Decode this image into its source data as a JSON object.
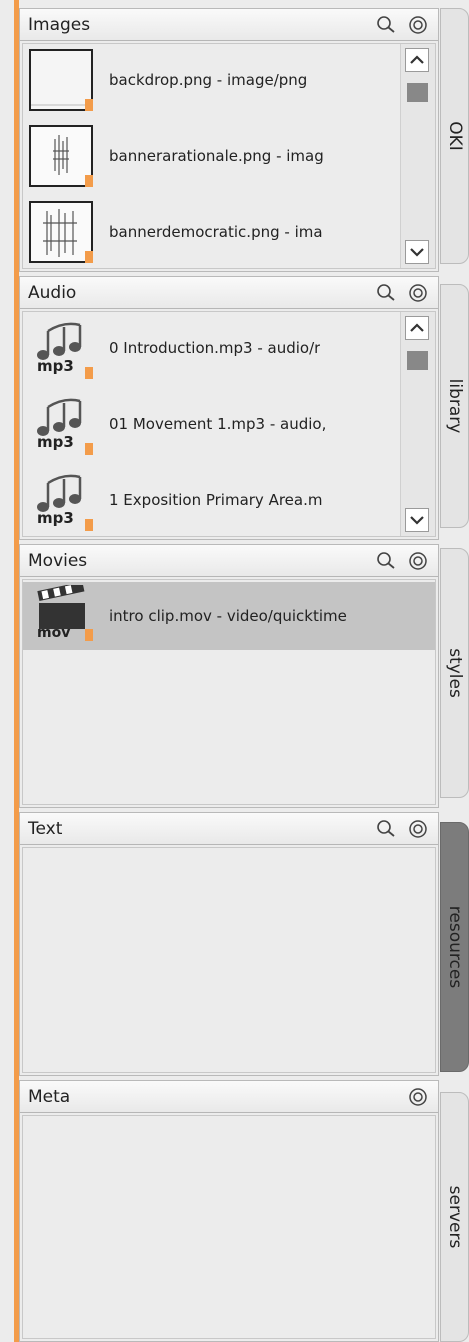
{
  "accent_color": "#f39c4a",
  "panels": {
    "images": {
      "title": "Images",
      "items": [
        {
          "label": "backdrop.png - image/png",
          "icon": "image-thumbnail-icon"
        },
        {
          "label": "bannerarationale.png - imag",
          "icon": "image-thumbnail-icon"
        },
        {
          "label": "bannerdemocratic.png - ima",
          "icon": "image-thumbnail-icon"
        }
      ]
    },
    "audio": {
      "title": "Audio",
      "items": [
        {
          "label": "0 Introduction.mp3 - audio/r",
          "icon": "mp3-icon",
          "badge": "mp3"
        },
        {
          "label": "01 Movement 1.mp3 - audio,",
          "icon": "mp3-icon",
          "badge": "mp3"
        },
        {
          "label": "1 Exposition Primary Area.m",
          "icon": "mp3-icon",
          "badge": "mp3"
        }
      ]
    },
    "movies": {
      "title": "Movies",
      "items": [
        {
          "label": "intro clip.mov - video/quicktime",
          "icon": "movie-clapboard-icon",
          "badge": "mov",
          "selected": true
        }
      ]
    },
    "text": {
      "title": "Text"
    },
    "meta": {
      "title": "Meta"
    }
  },
  "tabs": [
    {
      "label": "OKI",
      "active": false
    },
    {
      "label": "library",
      "active": false
    },
    {
      "label": "styles",
      "active": false
    },
    {
      "label": "resources",
      "active": true
    },
    {
      "label": "servers",
      "active": false
    }
  ]
}
